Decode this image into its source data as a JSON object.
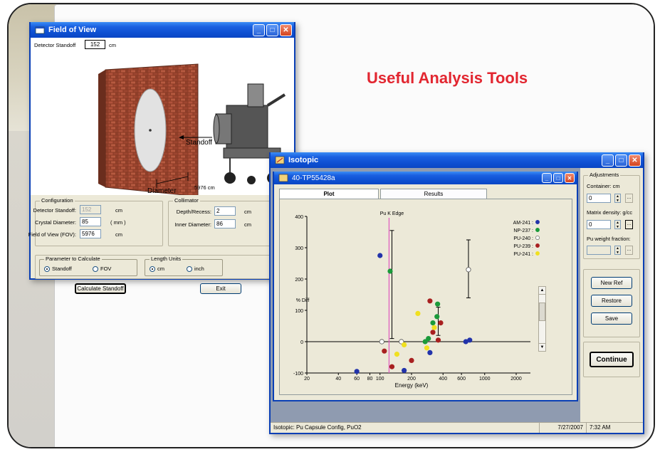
{
  "slide": {
    "headline": "Useful Analysis Tools",
    "accent_color": "#e22630"
  },
  "fov": {
    "title": "Field of View",
    "detector_standoff_label": "Detector Standoff",
    "detector_standoff_value": "152",
    "detector_standoff_unit": "cm",
    "illustration": {
      "standoff_label": "Standoff",
      "diameter_label": "Diameter",
      "distance_value": "5976",
      "distance_unit": "cm"
    },
    "configuration": {
      "caption": "Configuration",
      "detector_standoff_label": "Detector Standoff:",
      "detector_standoff_value": "152",
      "detector_standoff_unit": "cm",
      "crystal_diameter_label": "Crystal Diameter:",
      "crystal_diameter_value": "85",
      "crystal_diameter_unit": "( mm )",
      "fov_label": "Field of View (FOV):",
      "fov_value": "5976",
      "fov_unit": "cm"
    },
    "collimator": {
      "caption": "Collimator",
      "depth_label": "Depth/Recess:",
      "depth_value": "2",
      "depth_unit": "cm",
      "inner_label": "Inner Diameter:",
      "inner_value": "86",
      "inner_unit": "cm"
    },
    "parameter": {
      "caption": "Parameter to Calculate",
      "opt1": "Standoff",
      "opt2": "FOV"
    },
    "units": {
      "caption": "Length Units",
      "opt1": "cm",
      "opt2": "inch"
    },
    "calc_button": "Calculate Standoff",
    "exit_button": "Exit"
  },
  "iso": {
    "title": "Isotopic",
    "plotwin_title": "40-TP55428a",
    "tabs": [
      "Plot",
      "Results"
    ],
    "adjustments": {
      "caption": "Adjustments",
      "container_label": "Container: cm",
      "container_value": "0",
      "matrix_label": "Matrix density: g/cc",
      "matrix_value": "0",
      "pu_label": "Pu weight fraction:",
      "pu_value": ""
    },
    "buttons": {
      "new_ref": "New Ref",
      "restore": "Restore",
      "save": "Save",
      "continue": "Continue"
    },
    "status": {
      "left": "Isotopic: Pu Capsule Config, PuO2",
      "date": "7/27/2007",
      "time": "7:32 AM"
    }
  },
  "chart_data": {
    "type": "scatter",
    "title": "",
    "annotation": "Pu K Edge",
    "xlabel": "Energy (keV)",
    "ylabel": "% Diff",
    "x_scale": "log",
    "xlim": [
      20,
      2000
    ],
    "ylim": [
      -100,
      400
    ],
    "x_ticks": [
      20,
      40,
      60,
      80,
      100,
      200,
      400,
      600,
      1000,
      2000
    ],
    "y_ticks": [
      -100,
      0,
      100,
      200,
      300,
      400
    ],
    "k_edge_keV": 122,
    "series": [
      {
        "name": "AM-241",
        "color": "#2233aa",
        "points": [
          [
            60,
            -95
          ],
          [
            100,
            275
          ],
          [
            170,
            -92
          ],
          [
            300,
            -35
          ],
          [
            660,
            0
          ],
          [
            720,
            5
          ]
        ]
      },
      {
        "name": "NP-237",
        "color": "#1a9a3a",
        "points": [
          [
            125,
            225
          ],
          [
            270,
            0
          ],
          [
            290,
            10
          ],
          [
            320,
            60
          ],
          [
            350,
            80
          ],
          [
            355,
            120
          ]
        ]
      },
      {
        "name": "PU-240",
        "color": "#ffffff",
        "points": [
          [
            104,
            0
          ],
          [
            160,
            0
          ],
          [
            700,
            230
          ]
        ]
      },
      {
        "name": "PU-239",
        "color": "#a82020",
        "points": [
          [
            110,
            -30
          ],
          [
            130,
            -80
          ],
          [
            200,
            -60
          ],
          [
            300,
            130
          ],
          [
            320,
            30
          ],
          [
            360,
            5
          ],
          [
            380,
            60
          ]
        ]
      },
      {
        "name": "PU-241",
        "color": "#f0e020",
        "points": [
          [
            145,
            -40
          ],
          [
            170,
            -10
          ],
          [
            230,
            90
          ],
          [
            280,
            -20
          ],
          [
            330,
            45
          ]
        ]
      }
    ],
    "error_bars": [
      {
        "x": 130,
        "low": 10,
        "high": 355
      },
      {
        "x": 360,
        "low": 20,
        "high": 110
      },
      {
        "x": 700,
        "low": 140,
        "high": 325
      }
    ]
  }
}
